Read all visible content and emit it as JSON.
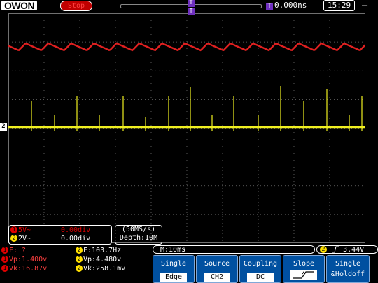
{
  "header": {
    "logo": "OWON",
    "run_state": "Stop",
    "trigger_marker": "T",
    "trigger_time": "0.000ns",
    "clock": "15:29",
    "usb": "⎓"
  },
  "channel_marker": "2",
  "channel_info": {
    "ch1": {
      "num": "1",
      "scale": "5V~",
      "pos": "0.00div"
    },
    "ch2": {
      "num": "2",
      "scale": "2V~",
      "pos": "0.00div"
    }
  },
  "sample": {
    "rate": "(50MS/s)",
    "depth": "Depth:10M"
  },
  "measurements": {
    "ch1": {
      "f": "F: ?",
      "vp": "Vp:1.400v",
      "vk": "Vk:16.87v"
    },
    "ch2": {
      "f": "F:103.7Hz",
      "vp": "Vp:4.480v",
      "vk": "Vk:258.1mv"
    }
  },
  "timebase": "M:10ms",
  "trigger_level": "3.44V",
  "trigger_source_num": "2",
  "menu": [
    {
      "label": "Single",
      "value": "Edge"
    },
    {
      "label": "Source",
      "value": "CH2"
    },
    {
      "label": "Coupling",
      "value": "DC"
    },
    {
      "label": "Slope",
      "value": "rising"
    },
    {
      "label": "Single",
      "value": "&Holdoff"
    }
  ],
  "colors": {
    "ch1": "#e02020",
    "ch2": "#f0f020",
    "grid": "#707070",
    "menu": "#0050a0"
  }
}
